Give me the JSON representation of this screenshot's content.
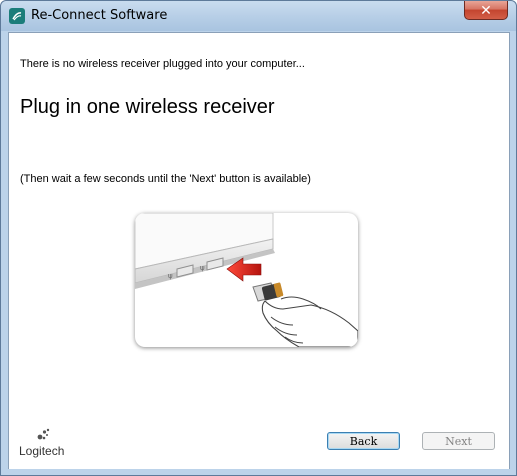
{
  "window": {
    "title": "Re-Connect Software",
    "close_glyph": "✕"
  },
  "content": {
    "status_message": "There is no wireless receiver plugged into your computer...",
    "headline": "Plug in one wireless receiver",
    "instruction": "(Then wait a few seconds until the 'Next' button is available)"
  },
  "illustration": {
    "description_icon": "usb-receiver-plug-icon",
    "arrow_color": "#d9231d"
  },
  "footer": {
    "logo_text": "Logitech",
    "back_label": "Back",
    "next_label": "Next"
  }
}
